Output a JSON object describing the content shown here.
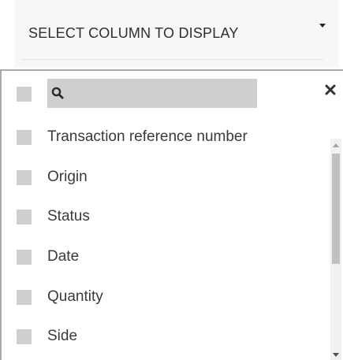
{
  "dropdown": {
    "label": "SELECT COLUMN TO DISPLAY"
  },
  "search": {
    "value": "",
    "placeholder": ""
  },
  "options": [
    {
      "label": "Transaction reference number"
    },
    {
      "label": "Origin"
    },
    {
      "label": "Status"
    },
    {
      "label": "Date"
    },
    {
      "label": "Quantity"
    },
    {
      "label": "Side"
    }
  ],
  "colors": {
    "checkbox": "#cfcfcf",
    "header_background": "#f7f7f7",
    "panel_border": "#a9a9a9"
  }
}
